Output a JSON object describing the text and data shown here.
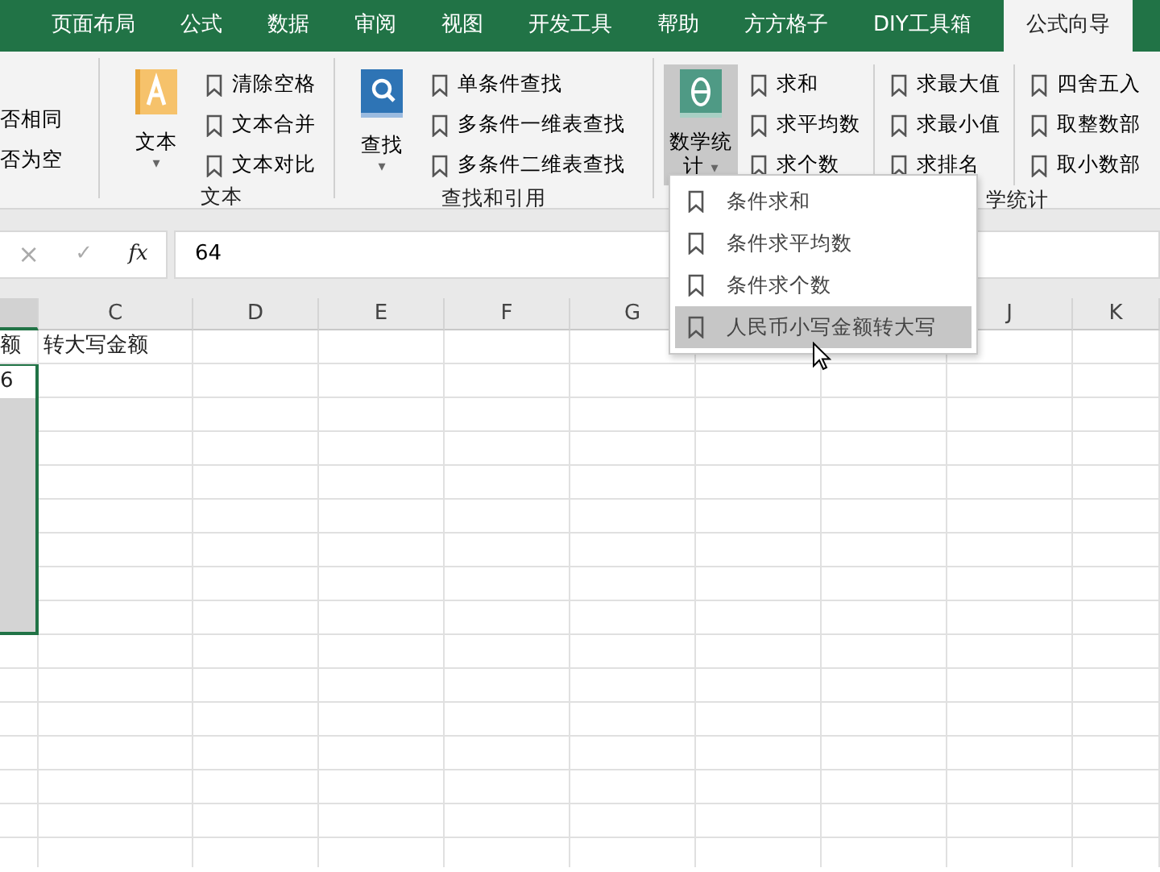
{
  "tabs": [
    {
      "label": "页面布局",
      "selected": false
    },
    {
      "label": "公式",
      "selected": false
    },
    {
      "label": "数据",
      "selected": false
    },
    {
      "label": "审阅",
      "selected": false
    },
    {
      "label": "视图",
      "selected": false
    },
    {
      "label": "开发工具",
      "selected": false
    },
    {
      "label": "帮助",
      "selected": false
    },
    {
      "label": "方方格子",
      "selected": false
    },
    {
      "label": "DIY工具箱",
      "selected": false
    },
    {
      "label": "公式向导",
      "selected": true
    }
  ],
  "ribbon": {
    "groups": [
      {
        "items": [
          [
            "否相同",
            "否为空"
          ]
        ]
      },
      {
        "label": "文本",
        "big": {
          "kind": "text",
          "label": "文本",
          "caret": "▾",
          "expanded": false
        },
        "items": [
          [
            "清除空格",
            "文本合并",
            "文本对比"
          ]
        ]
      },
      {
        "label": "查找和引用",
        "big": {
          "kind": "find",
          "label": "查找",
          "caret": "▾",
          "expanded": false
        },
        "items": [
          [
            "单条件查找",
            "多条件一维表查找",
            "多条件二维表查找"
          ]
        ]
      },
      {
        "label": "学统计",
        "big": {
          "kind": "math",
          "label": "数学统计",
          "caret": "▾",
          "expanded": true
        },
        "items": [
          [
            "求和",
            "求平均数",
            "求个数"
          ],
          [
            "求最大值",
            "求最小值",
            "求排名"
          ],
          [
            "四舍五入",
            "取整数部",
            "取小数部"
          ]
        ]
      }
    ]
  },
  "menu": [
    {
      "label": "条件求和",
      "selected": false
    },
    {
      "label": "条件求平均数",
      "selected": false
    },
    {
      "label": "条件求个数",
      "selected": false
    },
    {
      "label": "人民币小写金额转大写",
      "selected": true
    }
  ],
  "formula_bar": {
    "cancel": "×",
    "enter": "✓",
    "function": "fx",
    "value": "64"
  },
  "sheet": {
    "columns": [
      {
        "selected": true
      },
      {
        "label": "C",
        "selected": false
      },
      {
        "label": "D",
        "selected": false
      },
      {
        "label": "E",
        "selected": false
      },
      {
        "label": "F",
        "selected": false
      },
      {
        "label": "G",
        "selected": false
      },
      {},
      {},
      {
        "label": "J",
        "selected": false
      },
      {
        "label": "K",
        "selected": false
      }
    ],
    "rows": [
      {
        "cells": [
          "额",
          "转大写金额"
        ],
        "selected": false
      },
      {
        "cells": [
          "6"
        ],
        "selected": true
      },
      {
        "selected": true
      },
      {
        "selected": true
      },
      {
        "selected": true
      },
      {
        "selected": true
      },
      {
        "selected": true
      },
      {
        "selected": true
      },
      {
        "selected": true
      }
    ]
  }
}
